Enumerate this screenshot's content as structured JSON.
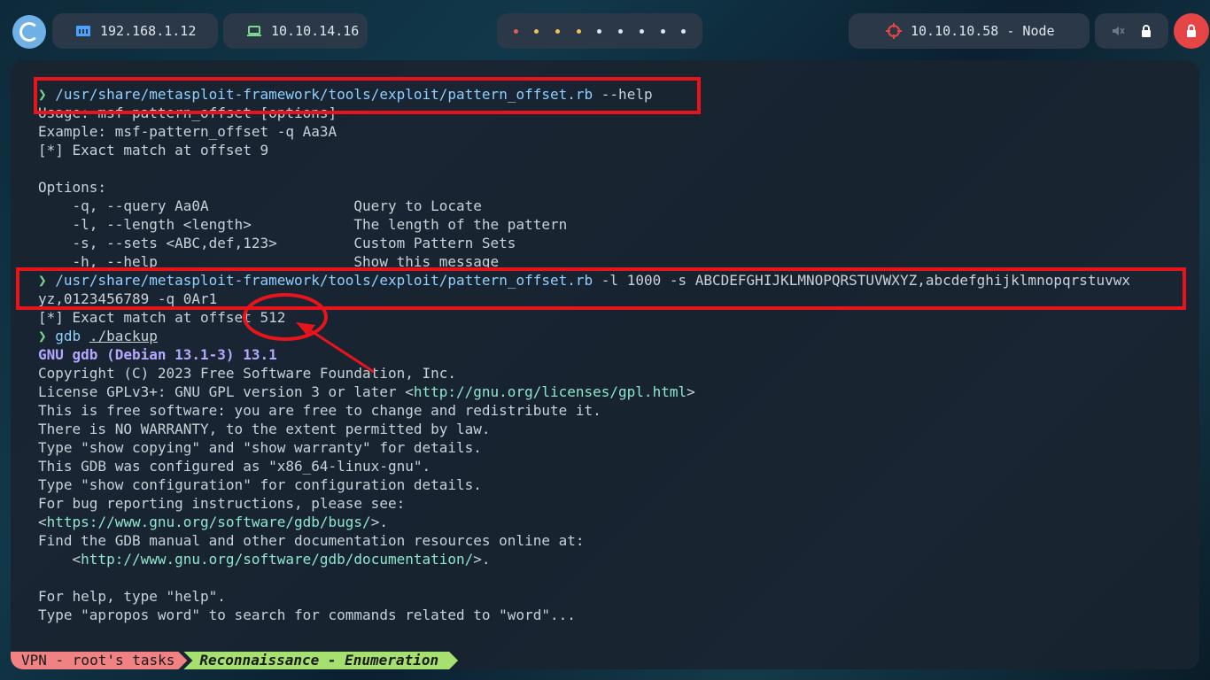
{
  "topbar": {
    "ip_local": "192.168.1.12",
    "ip_vpn": "10.10.14.16",
    "target": "10.10.10.58 - Node",
    "workspace_dot_colors": [
      "#e35b5b",
      "#f2c14e",
      "#f2c14e",
      "#f2c14e",
      "#dfe6ee",
      "#dfe6ee",
      "#dfe6ee",
      "#dfe6ee",
      "#dfe6ee"
    ],
    "accent_red": "#e64545",
    "accent_blue": "#6fb0e6",
    "accent_green": "#7bd88f",
    "icons": [
      "distro-logo-icon",
      "network-icon",
      "laptop-icon",
      "target-icon",
      "mute-icon",
      "lock-icon",
      "power-icon"
    ]
  },
  "terminal": {
    "cmd1": {
      "prompt": "❯",
      "path": "/usr/share/metasploit-framework/tools/exploit/pattern_offset.rb",
      "args": " --help"
    },
    "out1": [
      "Usage: msf-pattern_offset [options]",
      "Example: msf-pattern_offset -q Aa3A",
      "[*] Exact match at offset 9",
      "",
      "Options:",
      "    -q, --query Aa0A                 Query to Locate",
      "    -l, --length <length>            The length of the pattern",
      "    -s, --sets <ABC,def,123>         Custom Pattern Sets",
      "    -h, --help                       Show this message"
    ],
    "cmd2": {
      "prompt": "❯",
      "path": "/usr/share/metasploit-framework/tools/exploit/pattern_offset.rb",
      "args": " -l 1000 -s ABCDEFGHIJKLMNOPQRSTUVWXYZ,abcdefghijklmnopqrstuvwx",
      "cont": "yz,0123456789 -q 0Ar1"
    },
    "match_line": "[*] Exact match at offset 512",
    "cmd3": {
      "prompt": "❯",
      "cmd": "gdb",
      "arg": "./backup"
    },
    "gdb_banner": "GNU gdb (Debian 13.1-3) 13.1",
    "gdb_lines": {
      "copyright": "Copyright (C) 2023 Free Software Foundation, Inc.",
      "license_pre": "License GPLv3+: GNU GPL version 3 or later <",
      "license_url": "http://gnu.org/licenses/gpl.html",
      "license_post": ">",
      "free": "This is free software: you are free to change and redistribute it.",
      "warranty": "There is NO WARRANTY, to the extent permitted by law.",
      "show": "Type \"show copying\" and \"show warranty\" for details.",
      "configured": "This GDB was configured as \"x86_64-linux-gnu\".",
      "config": "Type \"show configuration\" for configuration details.",
      "bug": "For bug reporting instructions, please see:",
      "bug_url_pre": "<",
      "bug_url": "https://www.gnu.org/software/gdb/bugs/",
      "bug_url_post": ">.",
      "manual": "Find the GDB manual and other documentation resources online at:",
      "doc_pre": "    <",
      "doc_url": "http://www.gnu.org/software/gdb/documentation/",
      "doc_post": ">.",
      "blank": "",
      "help": "For help, type \"help\".",
      "apropos": "Type \"apropos word\" to search for commands related to \"word\"..."
    },
    "annotation_color": "#e8141c"
  },
  "statusbar": {
    "session": "VPN - root's tasks",
    "window": "Reconnaissance - Enumeration"
  }
}
